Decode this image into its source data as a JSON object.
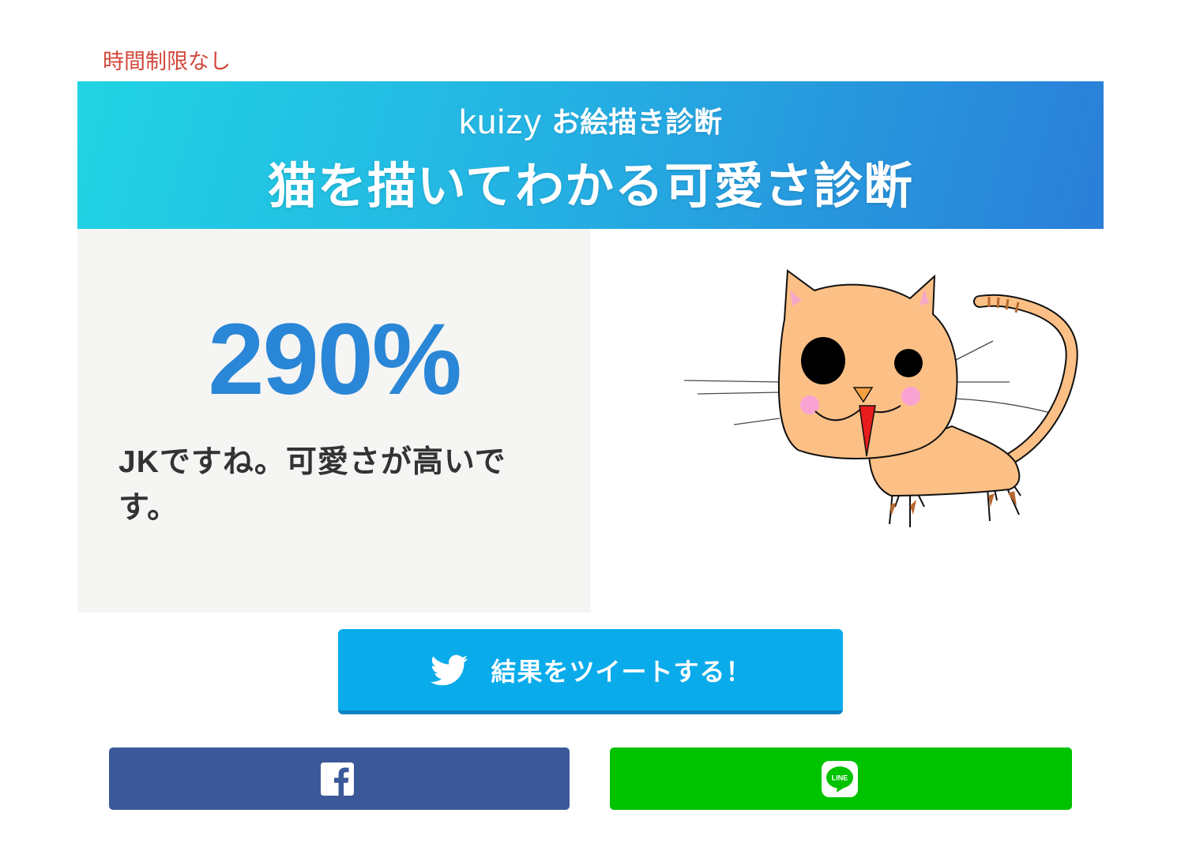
{
  "page": {
    "time_limit": "時間制限なし"
  },
  "banner": {
    "brand": "kuizy",
    "subtitle": "お絵描き診断",
    "title": "猫を描いてわかる可愛さ診断"
  },
  "result": {
    "score": "290%",
    "message": "JKですね。可愛さが高いです。"
  },
  "drawing": {
    "icon": "cat-drawing"
  },
  "share": {
    "tweet": {
      "label": "結果をツイートする！",
      "icon": "twitter-bird-icon"
    },
    "facebook": {
      "icon": "facebook-icon"
    },
    "line": {
      "icon": "line-icon",
      "logo_text": "LINE"
    }
  },
  "colors": {
    "accent": "#2a86d6",
    "red": "#d2483c",
    "twitter": "#0aabeb",
    "facebook": "#3b5998",
    "line": "#00c300"
  }
}
